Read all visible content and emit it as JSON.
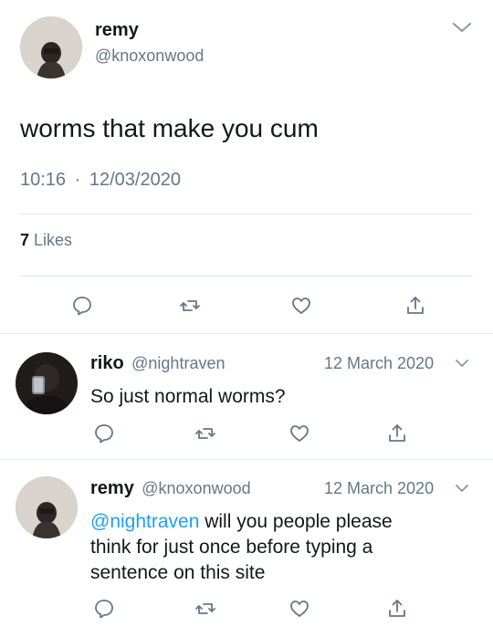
{
  "main_tweet": {
    "display_name": "remy",
    "handle": "@knoxonwood",
    "text": "worms that make you cum",
    "time": "10:16",
    "separator": "·",
    "date": "12/03/2020",
    "likes_count": "7",
    "likes_label": "Likes"
  },
  "replies": [
    {
      "display_name": "riko",
      "handle": "@nightraven",
      "date": "12 March 2020",
      "text": "So just normal worms?"
    },
    {
      "display_name": "remy",
      "handle": "@knoxonwood",
      "date": "12 March 2020",
      "mention": "@nightraven",
      "text_line1": " will you people please",
      "text_line2": "think for just once before typing a",
      "text_line3": "sentence on this site"
    }
  ],
  "icons": [
    "chevron-down-icon",
    "reply-icon",
    "retweet-icon",
    "like-icon",
    "share-icon"
  ],
  "colors": {
    "text": "#14171a",
    "muted": "#657786",
    "link": "#1da1f2",
    "divider": "#e1e8ed"
  }
}
